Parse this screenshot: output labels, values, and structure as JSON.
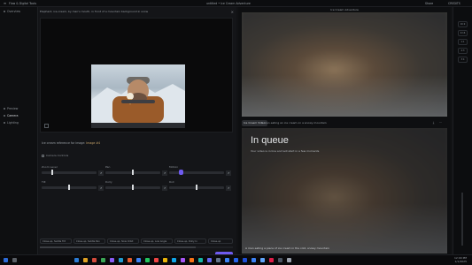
{
  "window": {
    "app_title": "Flow & Digital Tools",
    "doc_title": "untitled • Ice Cream Adventure",
    "share_label": "Share",
    "credits_label": "CREDITS"
  },
  "sidebar": {
    "top_label": "Overview",
    "items": [
      {
        "label": "Preview"
      },
      {
        "label": "Camera"
      },
      {
        "label": "Lighting"
      }
    ]
  },
  "editor": {
    "prompt_text": "Elephant, ice-cream, by man's mouth, in front of a mountain background in snow",
    "reference_label": "Ice cream reference for image:",
    "reference_link": "Image #4",
    "controls_title": "Camera Controls",
    "controls": [
      {
        "label": "Zoom Level",
        "value": 0.18
      },
      {
        "label": "Pan",
        "value": 0.5
      },
      {
        "label": "Motion",
        "value": 0.2
      },
      {
        "label": "Tilt",
        "value": 0.5
      },
      {
        "label": "Dolly",
        "value": 0.5
      },
      {
        "label": "Roll",
        "value": 0.5
      }
    ],
    "presets": [
      "Close-up, Subtle Tilt",
      "Close-up, Subtle Pan",
      "Close-up, Slow Orbit",
      "Close-up, Low Angle",
      "Close-up, Dolly In",
      "Close-up"
    ],
    "cost_label": "5 cr",
    "generate_label": "Generate"
  },
  "right_panel": {
    "header": "Ice Cream Adventure",
    "tab_label": "Ice Cream Video",
    "bar_text": "A man eating an ice cream on a snowy mountain",
    "queue_title": "In queue",
    "queue_sub": "Your video is in line and will start in a few moments",
    "tagline": "A man eating a piece of ice cream in the cold, snowy mountain"
  },
  "rail": [
    "16:9",
    "9:16",
    "1:1",
    "4:3",
    "3:4"
  ],
  "taskbar": {
    "time": "12:00 PM",
    "date": "1/1/2025"
  },
  "colors": {
    "accent": "#6f5bf0",
    "background": "#111214"
  }
}
